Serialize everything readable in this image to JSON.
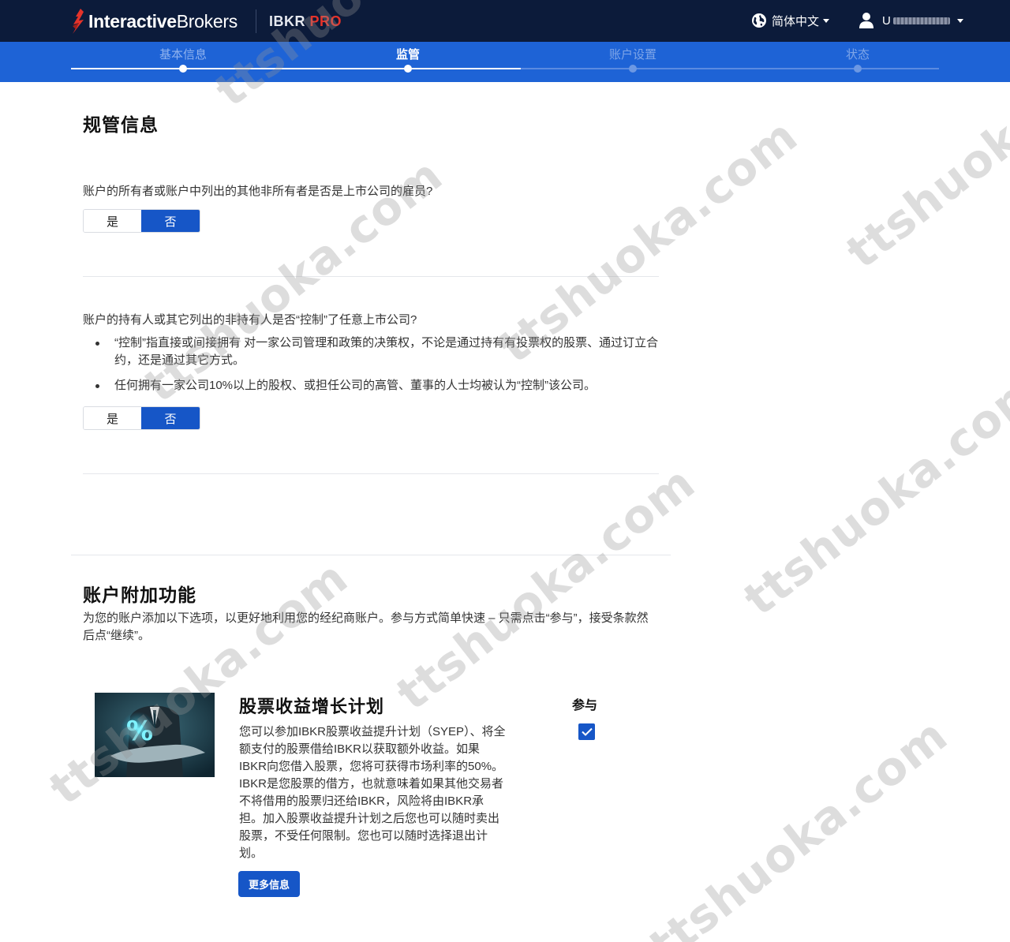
{
  "header": {
    "brand_bold": "Interactive",
    "brand_light": "Brokers",
    "product": "IBKR ",
    "product_accent": "PRO",
    "language": "简体中文",
    "user_prefix": "U"
  },
  "steps": [
    {
      "label": "基本信息",
      "state": "done"
    },
    {
      "label": "监管",
      "state": "active"
    },
    {
      "label": "账户设置",
      "state": "todo"
    },
    {
      "label": "状态",
      "state": "todo"
    }
  ],
  "regulatory": {
    "title": "规管信息",
    "q1": "账户的所有者或账户中列出的其他非所有者是否是上市公司的雇员?",
    "q1_yes": "是",
    "q1_no": "否",
    "q2": "账户的持有人或其它列出的非持有人是否“控制”了任意上市公司?",
    "q2_bullet1": "“控制”指直接或间接拥有 对一家公司管理和政策的决策权，不论是通过持有有投票权的股票、通过订立合约，还是通过其它方式。",
    "q2_bullet2": "任何拥有一家公司10%以上的股权、或担任公司的高管、董事的人士均被认为“控制”该公司。",
    "q2_yes": "是",
    "q2_no": "否"
  },
  "addons": {
    "title": "账户附加功能",
    "intro": "为您的账户添加以下选项，以更好地利用您的经纪商账户。参与方式简单快速 – 只需点击“参与”，接受条款然后点“继续”。",
    "join_label": "参与",
    "syep": {
      "title": "股票收益增长计划",
      "description": "您可以参加IBKR股票收益提升计划（SYEP）、将全额支付的股票借给IBKR以获取额外收益。如果IBKR向您借入股票，您将可获得市场利率的50%。 IBKR是您股票的借方，也就意味着如果其他交易者不将借用的股票归还给IBKR，风险将由IBKR承担。加入股票收益提升计划之后您也可以随时卖出股票，不受任何限制。您也可以随时选择退出计划。",
      "more_button": "更多信息",
      "joined": true,
      "image_badge": "%"
    }
  },
  "watermark": {
    "text": "ttshuoka.com"
  },
  "colors": {
    "navy": "#0c1b3a",
    "stepband": "#1e63d6",
    "primary": "#1656c7",
    "logo_red": "#e5332a"
  }
}
